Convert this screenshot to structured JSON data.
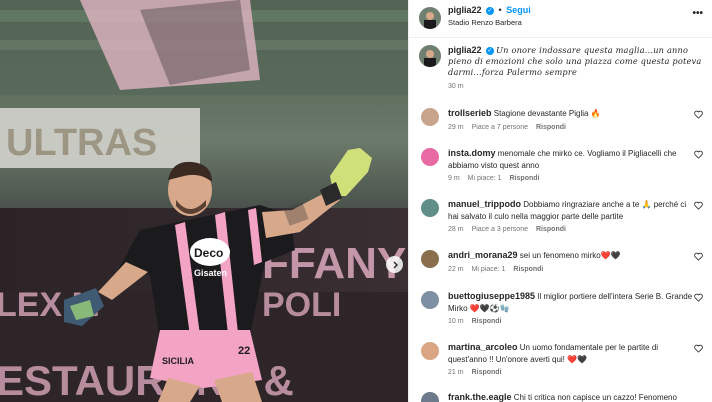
{
  "post": {
    "username": "piglia22",
    "verified_mark": "✓",
    "separator": "•",
    "follow_label": "Segui",
    "location": "Stadio Renzo Barbera",
    "more_icon": "more-horizontal-icon"
  },
  "caption": {
    "username": "piglia22",
    "text": "Un onore indossare questa maglia...un anno pieno di emozioni che solo una piazza come questa poteva darmi...forza Palermo sempre",
    "time": "30 m"
  },
  "photo": {
    "banner_text": "ULTRAS",
    "ad_text_1": "FFANY",
    "ad_text_2": "LEX M",
    "ad_text_3": "POLI",
    "ad_text_4": "ESTAURANT &",
    "shirt_sponsor": "Deco",
    "shirt_brand": "Gisaten",
    "shorts_text": "SICILIA",
    "number": "22"
  },
  "comments": [
    {
      "username": "trollserieb",
      "text": "Stagione devastante Piglia 🔥",
      "time": "29 m",
      "likes": "Piace a 7 persone",
      "reply": "Rispondi"
    },
    {
      "username": "insta.domy",
      "text": "menomale che mirko ce. Vogliamo il Pigliacelli che abbiamo visto quest anno",
      "time": "9 m",
      "likes": "Mi piace: 1",
      "reply": "Rispondi"
    },
    {
      "username": "manuel_trippodo",
      "text": "Dobbiamo ringraziare anche a te 🙏 perché ci hai salvato il culo nella maggior parte delle partite",
      "time": "28 m",
      "likes": "Piace a 3 persone",
      "reply": "Rispondi"
    },
    {
      "username": "andri_morana29",
      "text": "sei un fenomeno mirko❤️🖤",
      "time": "22 m",
      "likes": "Mi piace: 1",
      "reply": "Rispondi"
    },
    {
      "username": "buettogiuseppe1985",
      "text": "Il miglior portiere dell'intera Serie B. Grande Mirko ❤️🖤⚽🧤",
      "time": "10 m",
      "likes": "",
      "reply": "Rispondi"
    },
    {
      "username": "martina_arcoleo",
      "text": "Un uomo fondamentale per le partite di quest'anno !! Un'onore averti qui! ❤️🖤",
      "time": "21 m",
      "likes": "",
      "reply": "Rispondi"
    },
    {
      "username": "frank.the.eagle",
      "text": "Chi ti critica non capisce un cazzo! Fenomeno",
      "time": "",
      "likes": "",
      "reply": ""
    }
  ],
  "colors": {
    "accent": "#0095f6",
    "pink": "#f3a3c4",
    "muted": "#737373"
  }
}
